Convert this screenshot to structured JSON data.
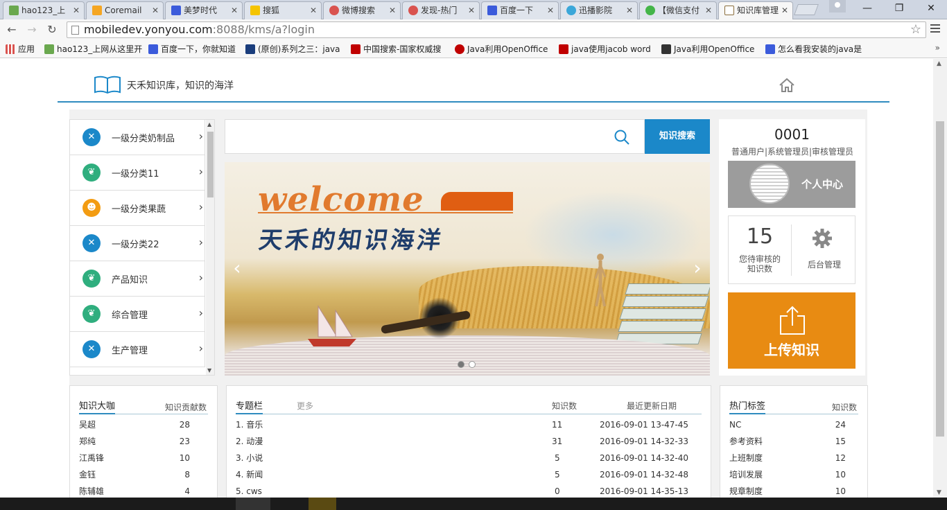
{
  "browser": {
    "tabs": [
      {
        "label": "hao123_上",
        "color": "#6aa84f",
        "active": false
      },
      {
        "label": "Coremail",
        "color": "#f5a623",
        "active": false
      },
      {
        "label": "美梦时代",
        "color": "#3b5bdb",
        "active": false
      },
      {
        "label": "搜狐",
        "color": "#f5c400",
        "active": false
      },
      {
        "label": "微博搜索",
        "color": "#d9534f",
        "active": false
      },
      {
        "label": "发现-热门",
        "color": "#d9534f",
        "active": false
      },
      {
        "label": "百度一下",
        "color": "#3b5bdb",
        "active": false
      },
      {
        "label": "迅播影院",
        "color": "#3ba7d9",
        "active": false
      },
      {
        "label": "【微信支付",
        "color": "#44b549",
        "active": false
      },
      {
        "label": "知识库管理",
        "color": "#8a6d3b",
        "active": true
      }
    ],
    "url_host": "mobiledev.yonyou.com",
    "url_path": ":8088/kms/a?login",
    "bookmarks": [
      {
        "label": "应用",
        "color": "#d9534f"
      },
      {
        "label": "hao123_上网从这里开",
        "color": "#6aa84f"
      },
      {
        "label": "百度一下，你就知道",
        "color": "#3b5bdb"
      },
      {
        "label": "(原创)系列之三：java",
        "color": "#1a3d7c"
      },
      {
        "label": "中国搜索-国家权威搜",
        "color": "#c00000"
      },
      {
        "label": "Java利用OpenOffice",
        "color": "#c00000"
      },
      {
        "label": "java使用jacob word",
        "color": "#c00000"
      },
      {
        "label": "Java利用OpenOffice",
        "color": "#333333"
      },
      {
        "label": "怎么看我安装的java是",
        "color": "#3b5bdb"
      }
    ]
  },
  "site": {
    "slogan": "天禾知识库，知识的海洋"
  },
  "categories": [
    {
      "label": "一级分类奶制品",
      "icon": "tools-icon",
      "color": "#1b88c9"
    },
    {
      "label": "一级分类11",
      "icon": "leaf-icon",
      "color": "#2fae7e"
    },
    {
      "label": "一级分类果蔬",
      "icon": "people-icon",
      "color": "#f39c12"
    },
    {
      "label": "一级分类22",
      "icon": "tools-icon",
      "color": "#1b88c9"
    },
    {
      "label": "产品知识",
      "icon": "leaf-icon",
      "color": "#2fae7e"
    },
    {
      "label": "综合管理",
      "icon": "leaf-icon",
      "color": "#2fae7e"
    },
    {
      "label": "生产管理",
      "icon": "tools-icon",
      "color": "#1b88c9"
    }
  ],
  "search": {
    "button_label": "知识搜索"
  },
  "banner": {
    "title": "welcome",
    "subtitle": "天禾的知识海洋"
  },
  "user": {
    "name": "0001",
    "roles": "普通用户|系统管理员|审核管理员",
    "center_label": "个人中心",
    "pending_count": "15",
    "pending_label": "您待审核的知识数",
    "admin_label": "后台管理",
    "upload_label": "上传知识"
  },
  "experts": {
    "title": "知识大咖",
    "col_label": "知识贡献数",
    "rows": [
      {
        "name": "吴超",
        "count": "28"
      },
      {
        "name": "郑纯",
        "count": "23"
      },
      {
        "name": "江禹锋",
        "count": "10"
      },
      {
        "name": "金钰",
        "count": "8"
      },
      {
        "name": "陈辅雄",
        "count": "4"
      }
    ]
  },
  "topics": {
    "title": "专题栏",
    "more_label": "更多",
    "col_count": "知识数",
    "col_date": "最近更新日期",
    "rows": [
      {
        "name": "1. 音乐",
        "count": "11",
        "date": "2016-09-01 13-47-45"
      },
      {
        "name": "2. 动漫",
        "count": "31",
        "date": "2016-09-01 14-32-33"
      },
      {
        "name": "3. 小说",
        "count": "5",
        "date": "2016-09-01 14-32-40"
      },
      {
        "name": "4. 新闻",
        "count": "5",
        "date": "2016-09-01 14-32-48"
      },
      {
        "name": "5. cws",
        "count": "0",
        "date": "2016-09-01 14-35-13"
      }
    ]
  },
  "tags": {
    "title": "热门标签",
    "col_label": "知识数",
    "rows": [
      {
        "name": "NC",
        "count": "24"
      },
      {
        "name": "参考资料",
        "count": "15"
      },
      {
        "name": "上班制度",
        "count": "12"
      },
      {
        "name": "培训发展",
        "count": "10"
      },
      {
        "name": "规章制度",
        "count": "10"
      }
    ]
  }
}
